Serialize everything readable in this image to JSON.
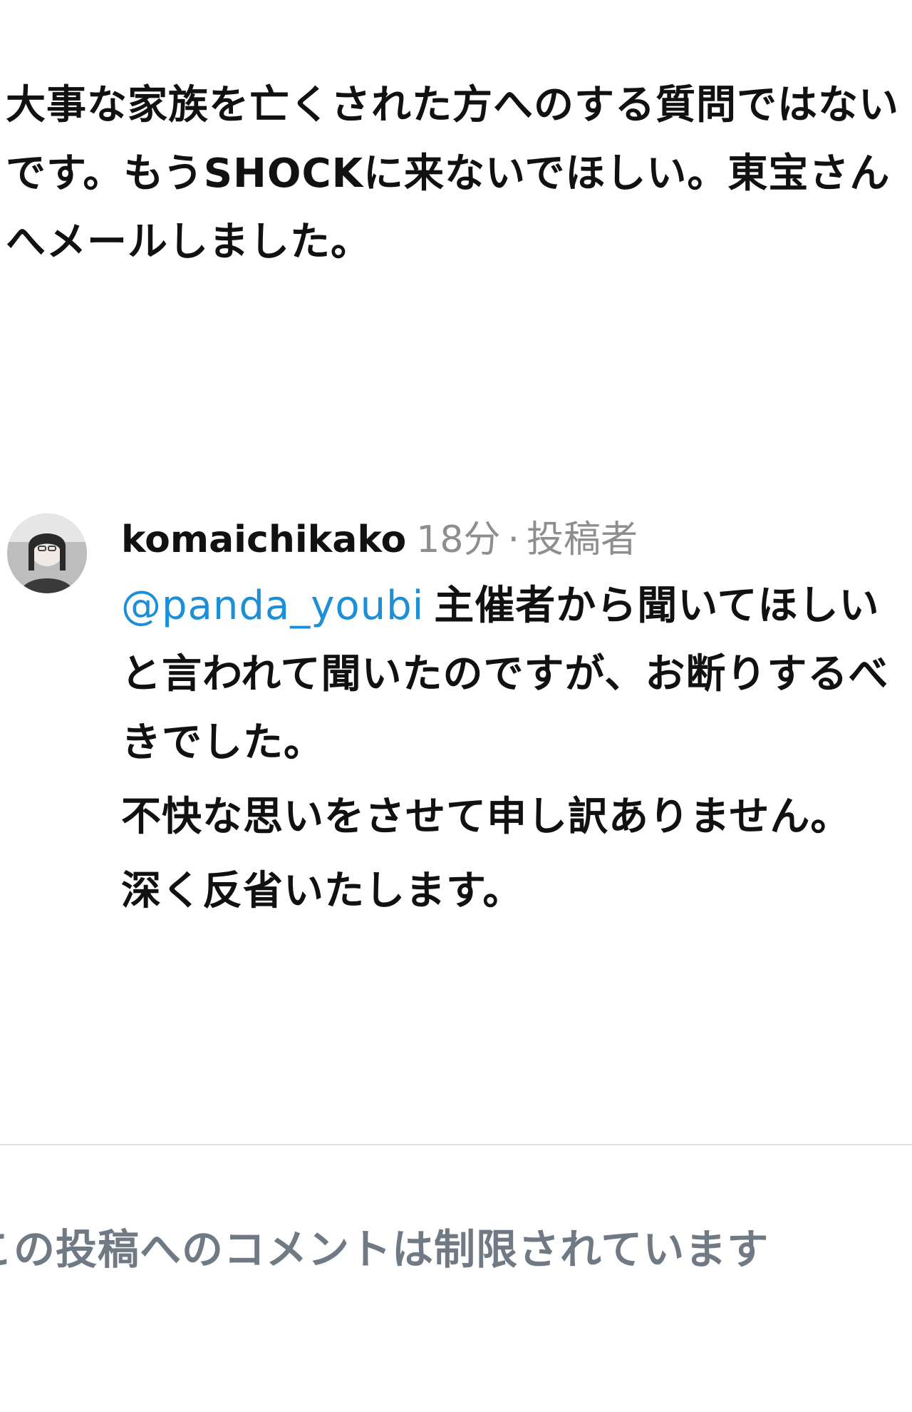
{
  "previous_comment": {
    "text": "大事な家族を亡くされた方へのする質問ではないです。もうSHOCKに来ないでほしい。東宝さんへメールしました。"
  },
  "comment": {
    "username": "komaichikako",
    "timestamp": "18分",
    "separator": "·",
    "author_tag": "投稿者",
    "mention": "@panda_youbi",
    "paragraphs": [
      "主催者から聞いてほしいと言われて聞いたのですが、お断りするべきでした。",
      "不快な思いをさせて申し訳ありません。",
      "深く反省いたします。"
    ]
  },
  "footer": {
    "restricted_notice": "この投稿へのコメントは制限されています"
  }
}
